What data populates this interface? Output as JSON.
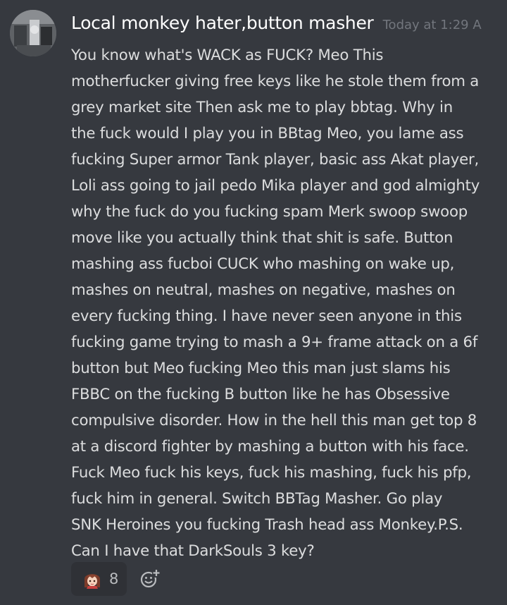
{
  "message": {
    "author": "Local monkey hater,button masher",
    "timestamp": "Today at 1:29 A",
    "avatar_icon": "user-avatar",
    "lines": [
      "You know what's WACK as FUCK? Meo This",
      "motherfucker giving free keys like he stole them from a",
      "grey market site Then ask me to play bbtag. Why in",
      "the fuck would I play you in BBtag Meo, you lame ass",
      "fucking Super armor Tank player, basic ass Akat player,",
      "Loli ass going to jail pedo Mika player and god almighty",
      "why the fuck do you fucking spam Merk swoop swoop",
      "move like you actually think that shit is safe. Button",
      "mashing ass fucboi CUCK who mashing on wake up,",
      "mashes on neutral, mashes on negative, mashes on",
      "every fucking thing. I have never seen anyone in this",
      "fucking game trying to mash a 9+ frame attack on a 6f",
      "button but Meo fucking Meo this man just slams his",
      "FBBC on the fucking B button  like he has Obsessive",
      "compulsive disorder. How in the hell this man get top 8",
      "at a discord fighter by mashing a button with his face.",
      "Fuck Meo fuck his keys, fuck his mashing, fuck his pfp,",
      "fuck him in general. Switch BBTag Masher. Go play",
      "SNK Heroines  you fucking Trash head ass Monkey.P.S.",
      "Can I have that DarkSouls 3 key?"
    ],
    "reactions": [
      {
        "emoji": "anime-girl-emoji",
        "count": "8"
      }
    ],
    "add_reaction_icon": "add-reaction-icon"
  },
  "colors": {
    "background": "#36393f",
    "username": "#ffffff",
    "timestamp": "#72767d",
    "message_text": "#dcddde",
    "reaction_bg": "#2f3136",
    "reaction_count": "#b9bbbe"
  }
}
